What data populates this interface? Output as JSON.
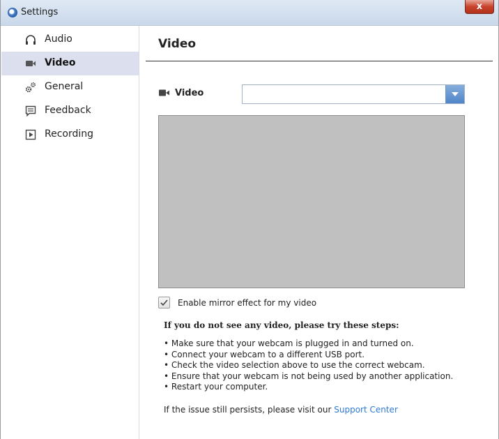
{
  "window": {
    "title": "Settings",
    "close_label": "x"
  },
  "sidebar": {
    "items": [
      {
        "label": "Audio",
        "icon": "headphones-icon",
        "active": false
      },
      {
        "label": "Video",
        "icon": "video-camera-icon",
        "active": true
      },
      {
        "label": "General",
        "icon": "gears-icon",
        "active": false
      },
      {
        "label": "Feedback",
        "icon": "feedback-icon",
        "active": false
      },
      {
        "label": "Recording",
        "icon": "recording-icon",
        "active": false
      }
    ]
  },
  "main": {
    "title": "Video",
    "video_select": {
      "label": "Video",
      "value": ""
    },
    "mirror": {
      "label": "Enable mirror effect for my video",
      "checked": true
    },
    "help": {
      "title": "If you do not see any video, please try these steps:",
      "steps": [
        "Make sure that your webcam is plugged in and turned on.",
        "Connect your webcam to a different USB port.",
        "Check the video selection above to use the correct webcam.",
        "Ensure that your webcam is not being used by another application.",
        "Restart your computer."
      ],
      "footer_text": "If the issue still persists, please visit our ",
      "footer_link": "Support Center"
    }
  },
  "colors": {
    "active_nav": "#dcdfee",
    "link": "#2d7ad5",
    "preview": "#c0c0c0",
    "dropdown_button": "#4f86c9"
  }
}
